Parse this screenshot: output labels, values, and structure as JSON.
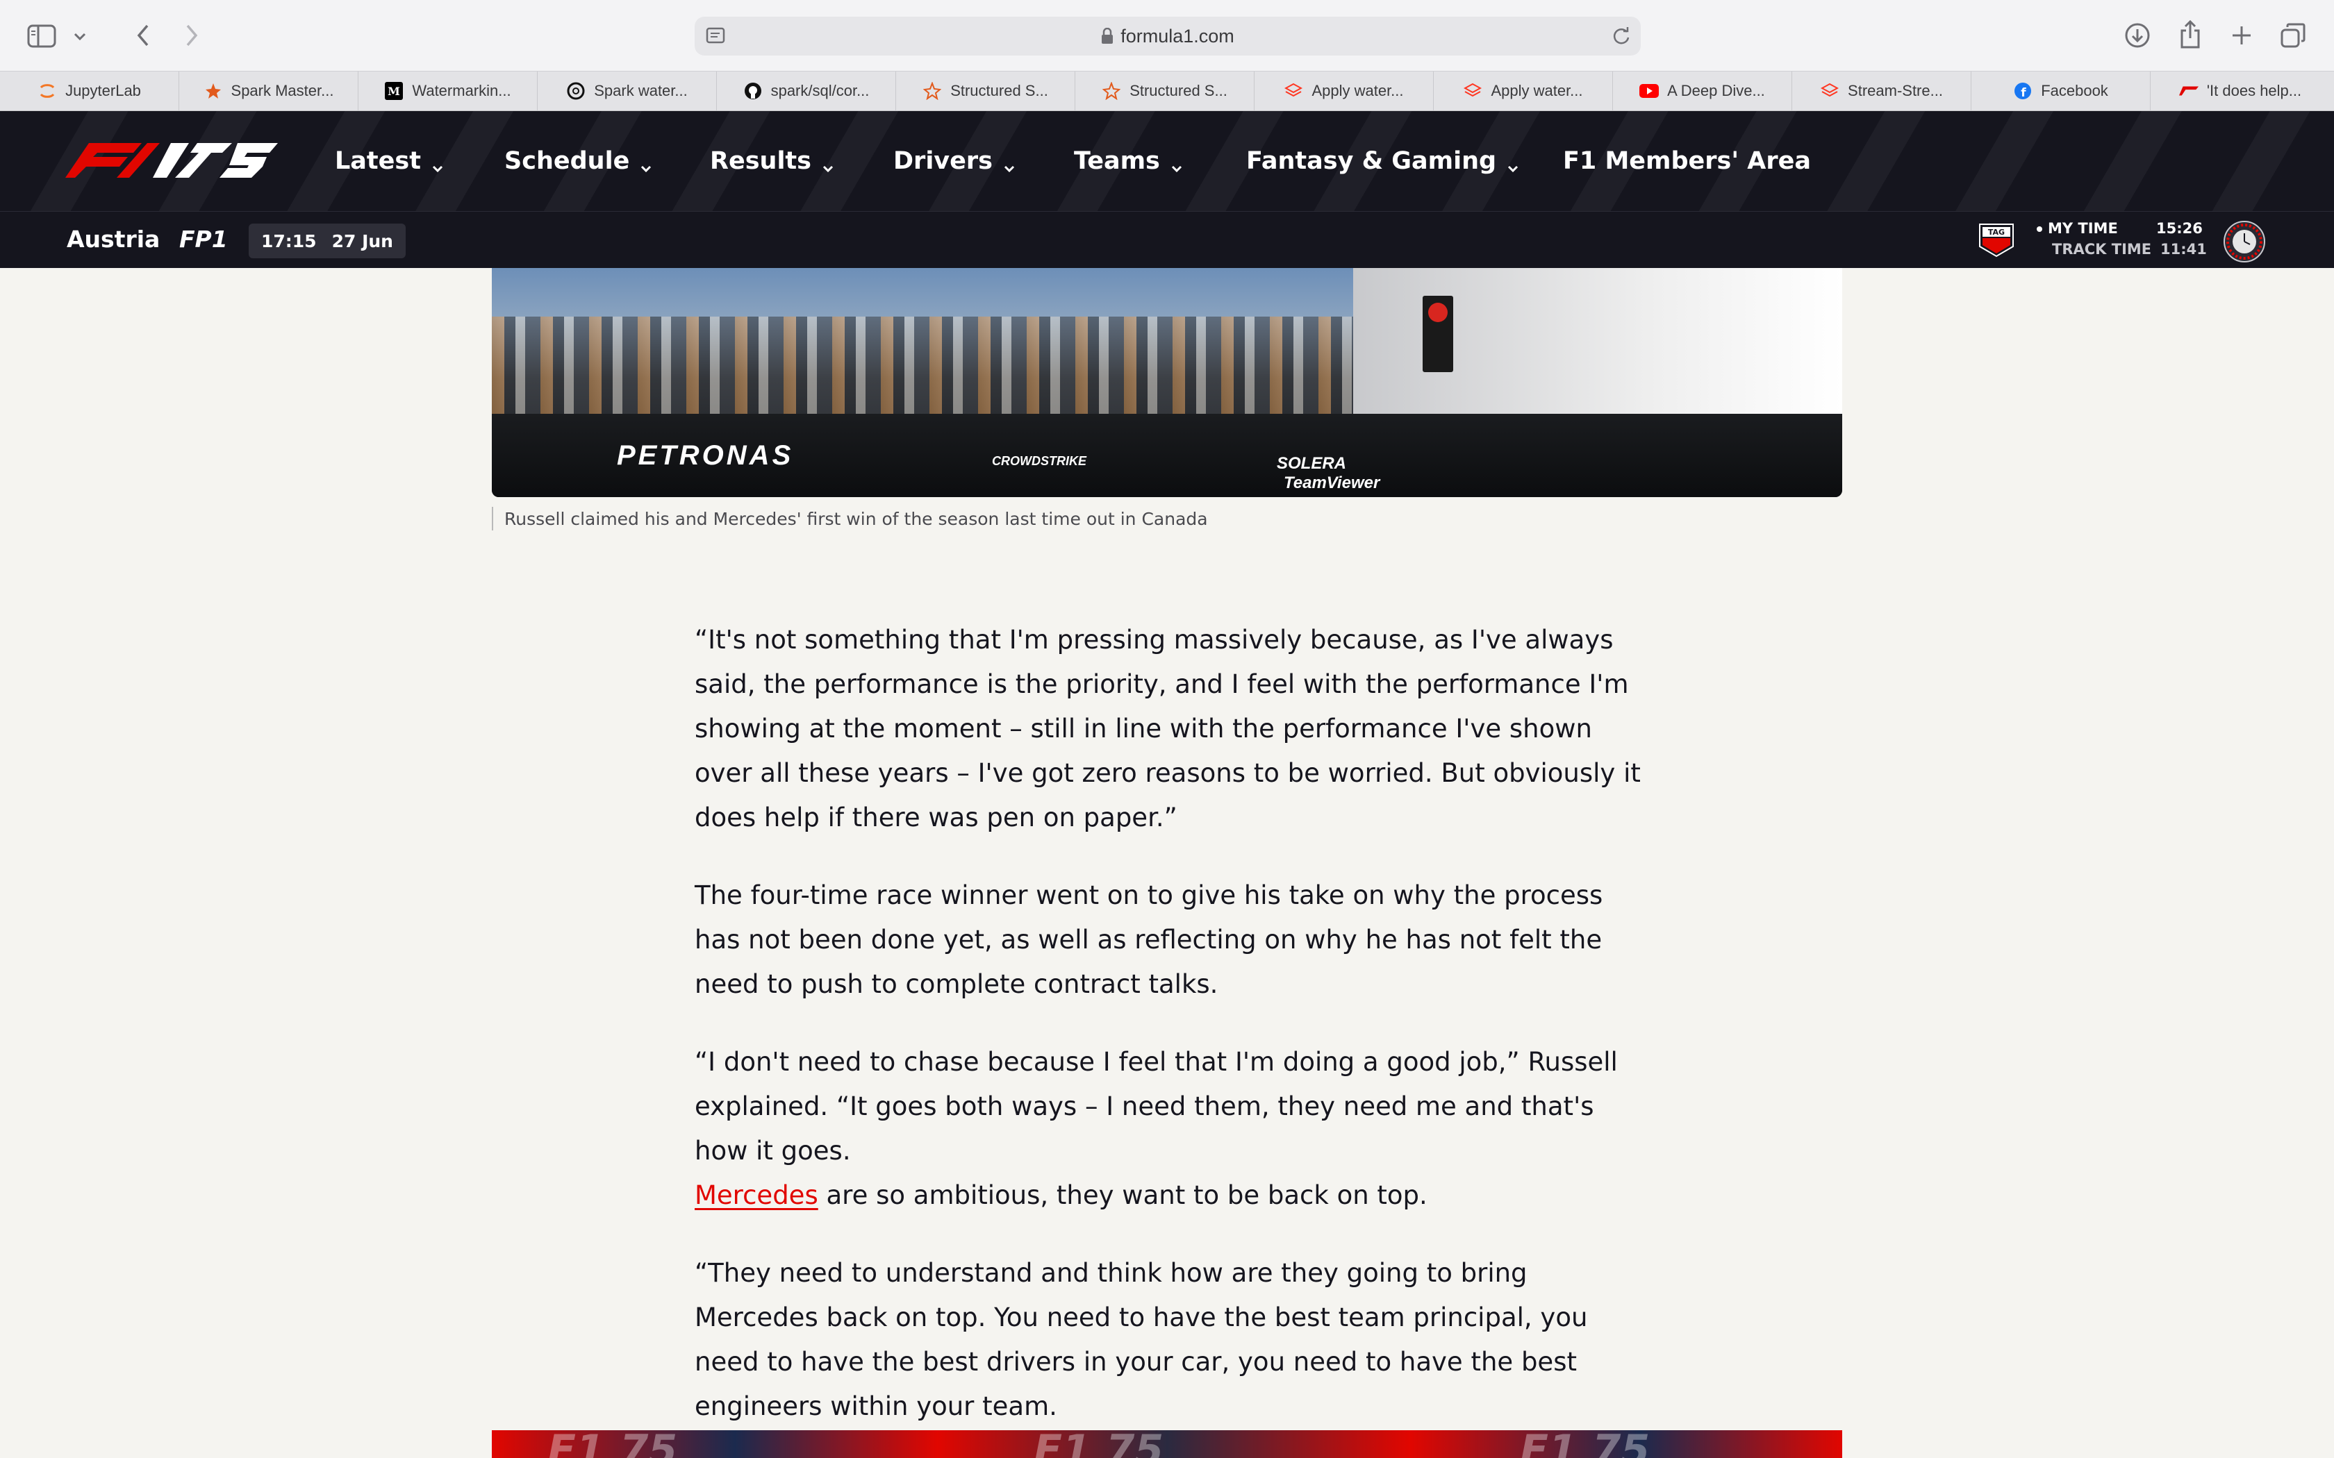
{
  "browser": {
    "url": "formula1.com",
    "tabs": [
      {
        "label": "JupyterLab",
        "icon": "jupyter-icon"
      },
      {
        "label": "Spark Master...",
        "icon": "spark-icon"
      },
      {
        "label": "Watermarkin...",
        "icon": "medium-icon"
      },
      {
        "label": "Spark water...",
        "icon": "openai-icon"
      },
      {
        "label": "spark/sql/cor...",
        "icon": "github-icon"
      },
      {
        "label": "Structured S...",
        "icon": "star-icon"
      },
      {
        "label": "Structured S...",
        "icon": "star-icon"
      },
      {
        "label": "Apply water...",
        "icon": "databricks-icon"
      },
      {
        "label": "Apply water...",
        "icon": "databricks-icon"
      },
      {
        "label": "A Deep Dive...",
        "icon": "youtube-icon"
      },
      {
        "label": "Stream-Stre...",
        "icon": "databricks-icon"
      },
      {
        "label": "Facebook",
        "icon": "facebook-icon"
      },
      {
        "label": "'It does help...",
        "icon": "f1-icon"
      }
    ]
  },
  "nav": {
    "logo": "F1 75",
    "items": [
      {
        "label": "Latest",
        "dropdown": true
      },
      {
        "label": "Schedule",
        "dropdown": true
      },
      {
        "label": "Results",
        "dropdown": true
      },
      {
        "label": "Drivers",
        "dropdown": true
      },
      {
        "label": "Teams",
        "dropdown": true
      },
      {
        "label": "Fantasy & Gaming",
        "dropdown": true
      },
      {
        "label": "F1 Members' Area",
        "dropdown": false
      }
    ]
  },
  "session_bar": {
    "country": "Austria",
    "session": "FP1",
    "time": "17:15",
    "date": "27 Jun",
    "my_time_label": "MY TIME",
    "track_time_label": "TRACK TIME",
    "my_time": "15:26",
    "track_time": "11:41",
    "sponsor": "TAG HEUER"
  },
  "article": {
    "hero_decals": [
      "PETRONAS",
      "SOLERA",
      "TeamViewer",
      "CROWDSTRIKE"
    ],
    "caption": "Russell claimed his and Mercedes' first win of the season last time out in Canada",
    "paragraphs": [
      "“It's not something that I'm pressing massively because, as I've always said, the performance is the priority, and I feel with the performance I'm showing at the moment – still in line with the performance I've shown over all these years – I've got zero reasons to be worried. But obviously it does help if there was pen on paper.”",
      "The four-time race winner went on to give his take on why the process has not been done yet, as well as reflecting on why he has not felt the need to push to complete contract talks."
    ],
    "p3_before": "“I don't need to chase because I feel that I'm doing a good job,” Russell explained. “It goes both ways – I need them, they need me and that's how it goes.",
    "p3_link": "Mercedes",
    "p3_after": " are so ambitious, they want to be back on top.",
    "p4": "“They need to understand and think how are they going to bring Mercedes back on top. You need to have the best team principal, you need to have the best drivers in your car, you need to have the best engineers within your team."
  },
  "colors": {
    "f1_red": "#e10600",
    "nav_bg": "#15151e",
    "page_bg": "#f5f4f0"
  }
}
